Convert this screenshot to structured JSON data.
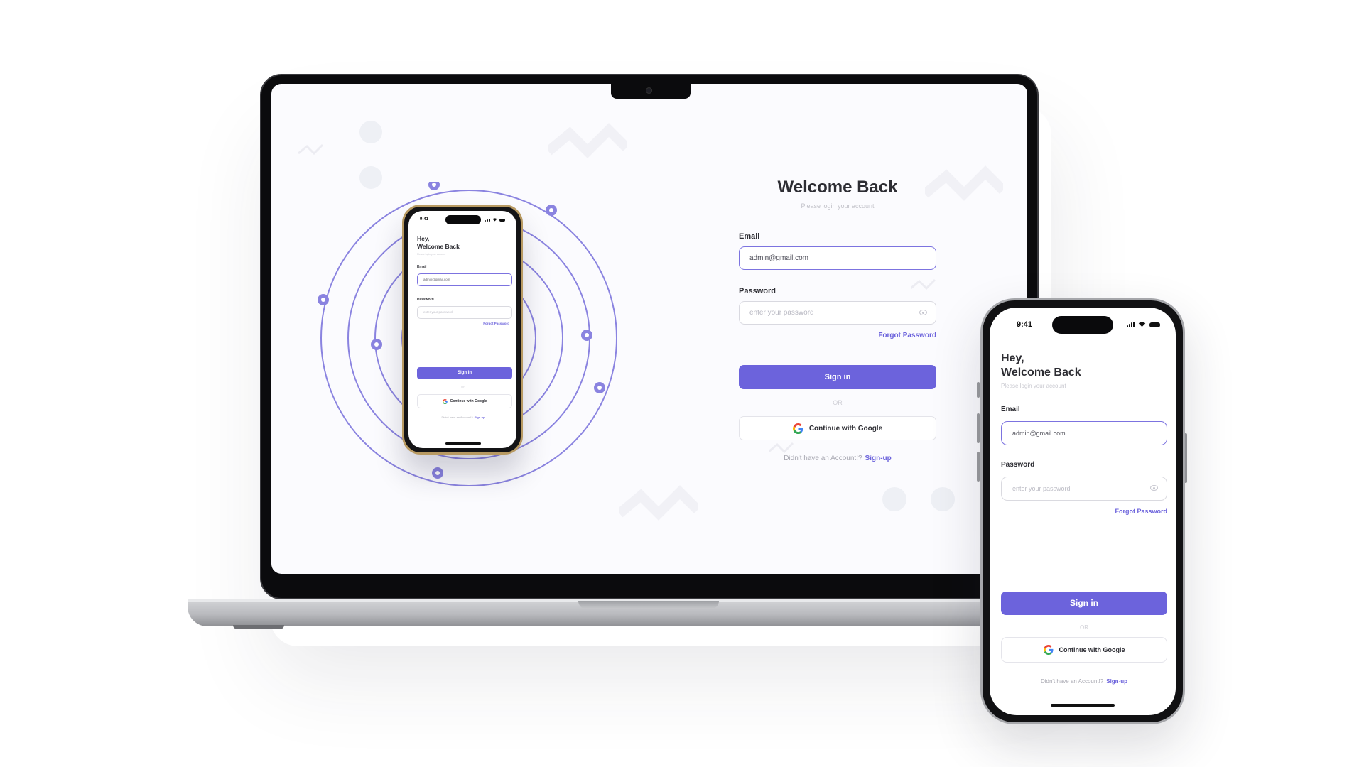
{
  "colors": {
    "accent": "#6c63dc",
    "text": "#2d2d33",
    "muted": "#c2c2c9",
    "orbit": "#8a83e0"
  },
  "desktop": {
    "title": "Welcome Back",
    "subtitle": "Please login your account",
    "email_label": "Email",
    "email_value": "admin@gmail.com",
    "password_label": "Password",
    "password_placeholder": "enter your password",
    "forgot_password": "Forgot Password",
    "signin_label": "Sign in",
    "or_label": "OR",
    "google_label": "Continue with Google",
    "signup_prompt": "Didn't have an Account!?",
    "signup_link": "Sign-up"
  },
  "mobile": {
    "status_time": "9:41",
    "greeting_line1": "Hey,",
    "greeting_line2": "Welcome Back",
    "subtitle": "Please login your account",
    "email_label": "Email",
    "email_value": "admin@gmail.com",
    "password_label": "Password",
    "password_placeholder": "enter your password",
    "forgot_password": "Forgot Password",
    "signin_label": "Sign in",
    "or_label": "OR",
    "google_label": "Continue with Google",
    "signup_prompt": "Didn't have an Account!?",
    "signup_link": "Sign-up"
  },
  "icons": [
    "google-icon",
    "eye-icon",
    "location-pin-icon",
    "signal-icon",
    "wifi-icon",
    "battery-icon",
    "camera-icon"
  ]
}
